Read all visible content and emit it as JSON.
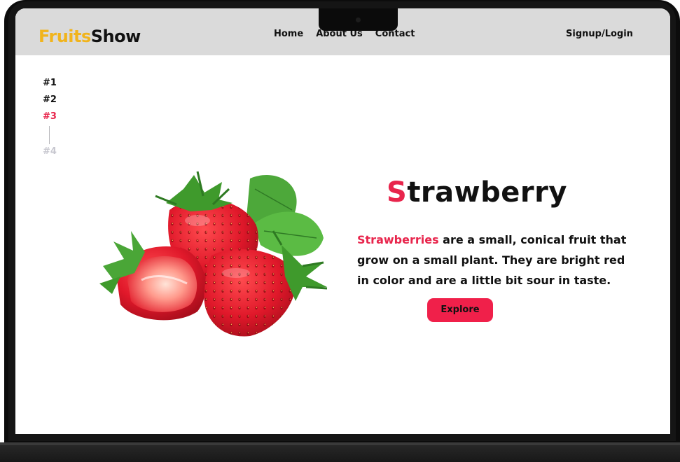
{
  "logo": {
    "part1": "Fruits",
    "part2": "Show"
  },
  "nav": [
    {
      "label": "Home"
    },
    {
      "label": "About Us"
    },
    {
      "label": "Contact"
    }
  ],
  "auth": {
    "label": "Signup/Login"
  },
  "slides": [
    {
      "label": "#1",
      "state": "normal"
    },
    {
      "label": "#2",
      "state": "normal"
    },
    {
      "label": "#3",
      "state": "active"
    },
    {
      "label": "#4",
      "state": "inactive"
    }
  ],
  "hero": {
    "title_first": "S",
    "title_rest": "trawberry",
    "desc_highlight": "Strawberries",
    "desc_rest": " are a small, conical fruit that grow on a small plant. They are bright red in color and are a little bit sour in taste.",
    "button": "Explore",
    "image_icon": "strawberries-image"
  },
  "colors": {
    "accent": "#e8254c",
    "logo_yellow": "#f1b41c",
    "header_bg": "#dadada",
    "button_bg": "#f0204a"
  }
}
